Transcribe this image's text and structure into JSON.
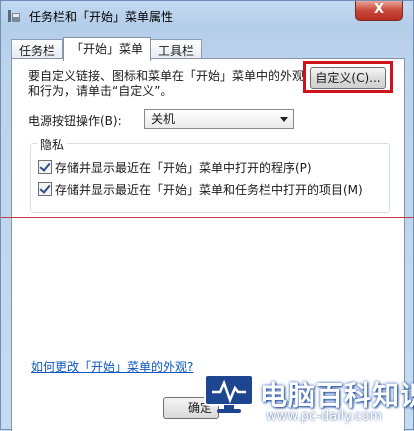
{
  "window": {
    "title": "任务栏和「开始」菜单属性",
    "close_label": "X"
  },
  "tabs": [
    {
      "label": "任务栏",
      "active": false
    },
    {
      "label": "「开始」菜单",
      "active": true
    },
    {
      "label": "工具栏",
      "active": false
    }
  ],
  "customize": {
    "description": "要自定义链接、图标和菜单在「开始」菜单中的外观和行为，请单击“自定义”。",
    "button_label": "自定义(C)..."
  },
  "power": {
    "label": "电源按钮操作(B):",
    "selected": "关机"
  },
  "privacy": {
    "title": "隐私",
    "options": [
      {
        "label": "存储并显示最近在「开始」菜单中打开的程序(P)",
        "checked": true
      },
      {
        "label": "存储并显示最近在「开始」菜单和任务栏中打开的项目(M)",
        "checked": true
      }
    ]
  },
  "help_link": "如何更改「开始」菜单的外观?",
  "ok_button": "确定",
  "watermark": {
    "title": "电脑百科知识",
    "url": "www.pc-daily.com"
  },
  "colors": {
    "highlight": "#d0121b",
    "link": "#0b57c0",
    "watermark_blue": "#1d4590"
  }
}
